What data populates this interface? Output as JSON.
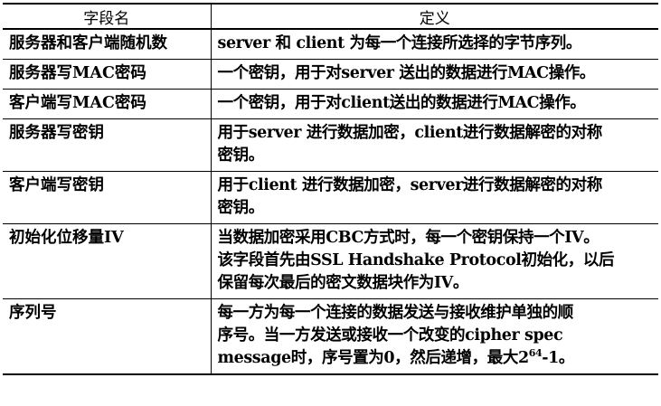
{
  "table": {
    "headers": {
      "field": "字段名",
      "definition": "定义"
    },
    "rows": [
      {
        "name": "服务器和客户端随机数",
        "definition": "server 和 client 为每一个连接所选择的字节序列。"
      },
      {
        "name": "服务器写MAC密码",
        "definition": "一个密钥，用于对server 送出的数据进行MAC操作。"
      },
      {
        "name": "客户端写MAC密码",
        "definition": "一个密钥，用于对client送出的数据进行MAC操作。"
      },
      {
        "name": "服务器写密钥",
        "definition": "用于server 进行数据加密，client进行数据解密的对称\n密钥。"
      },
      {
        "name": "客户端写密钥",
        "definition": "用于client 进行数据加密，server进行数据解密的对称\n密钥。"
      },
      {
        "name": "初始化位移量IV",
        "definition": "当数据加密采用CBC方式时，每一个密钥保持一个IV。\n该字段首先由SSL Handshake Protocol初始化，以后\n保留每次最后的密文数据块作为IV。"
      },
      {
        "name": "序列号",
        "definition_before": "每一方为每一个连接的数据发送与接收维护单独的顺\n序号。当一方发送或接收一个改变的cipher spec\nmessage时，序号置为0，然后递增，最大2",
        "definition_exponent": "64",
        "definition_after": "-1。"
      }
    ]
  }
}
